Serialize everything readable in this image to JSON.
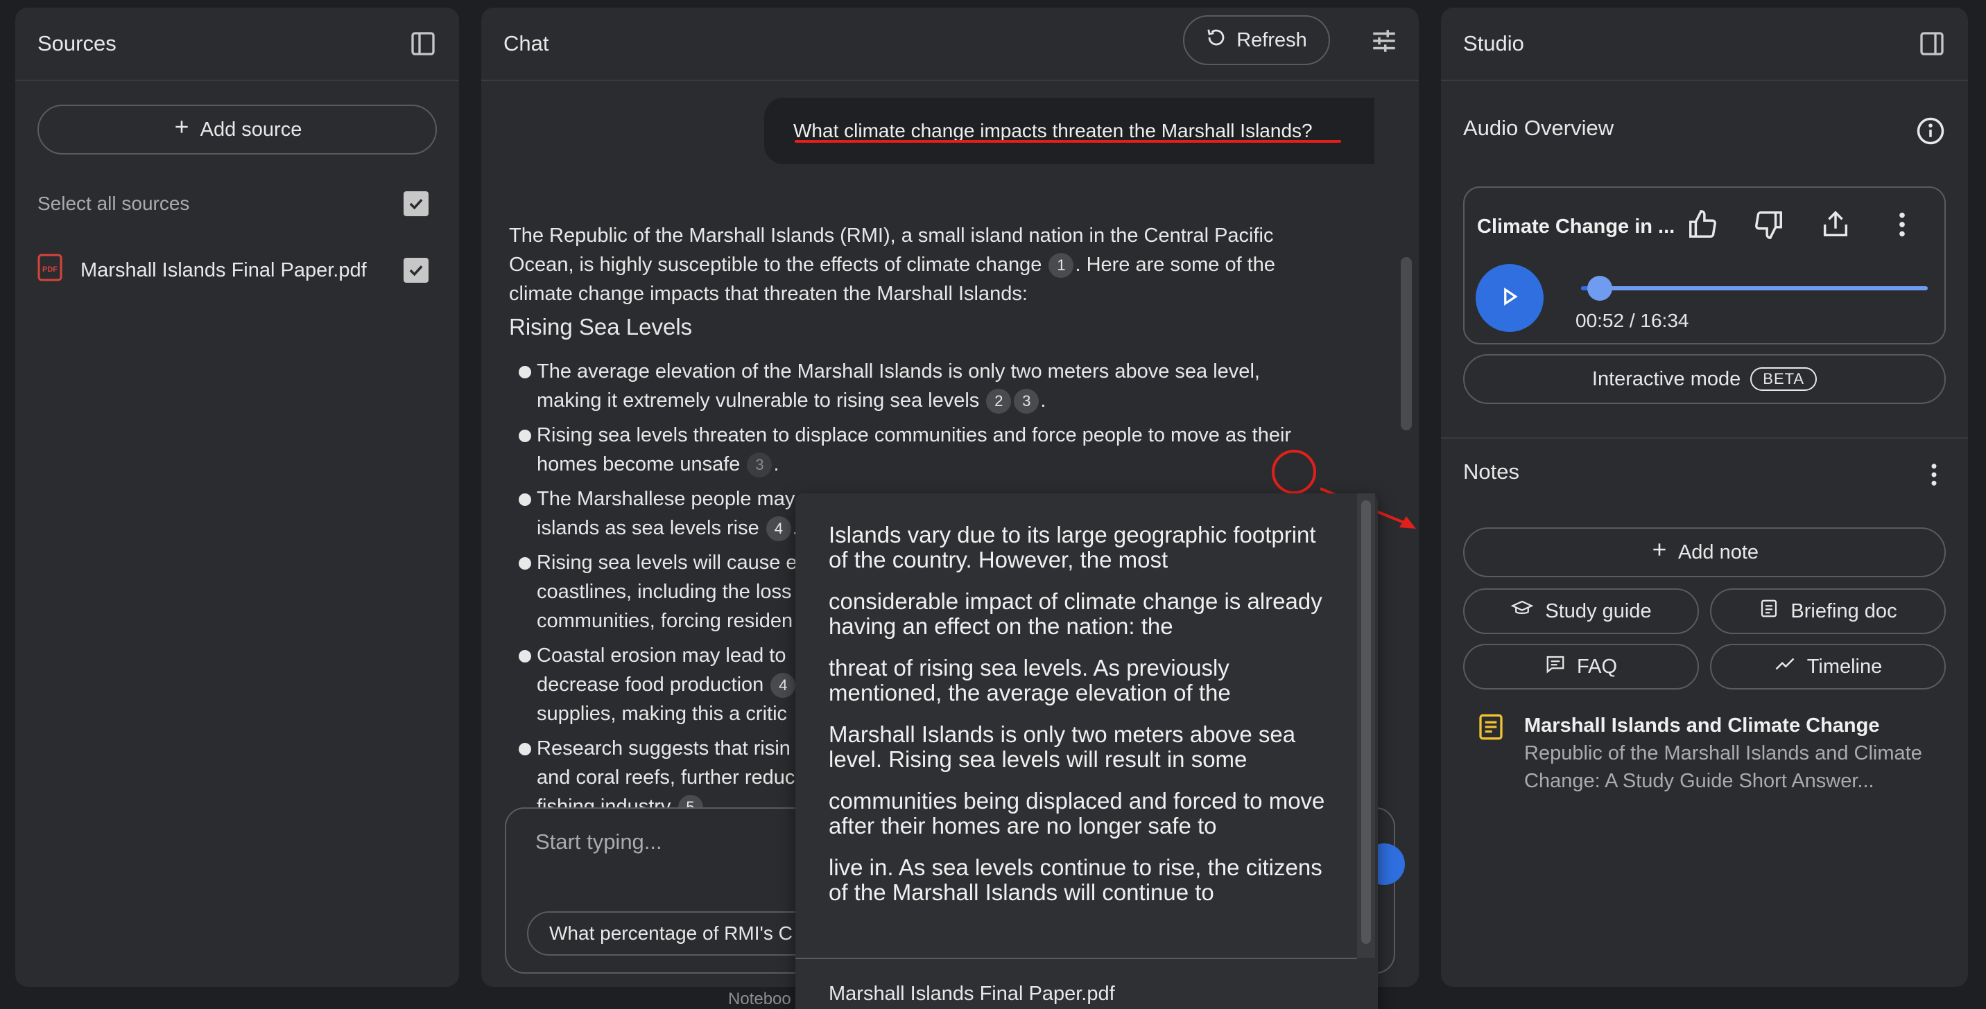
{
  "sources": {
    "title": "Sources",
    "add_source_label": "Add source",
    "select_all_label": "Select all sources",
    "items": [
      {
        "name": "Marshall Islands Final Paper.pdf",
        "type": "PDF"
      }
    ]
  },
  "chat": {
    "title": "Chat",
    "refresh_label": "Refresh",
    "user_question": "What climate change impacts threaten the Marshall Islands?",
    "intro_part1": "The Republic of the Marshall Islands (RMI), a small island nation in the Central Pacific Ocean, is highly susceptible to the effects of climate change",
    "intro_cite": "1",
    "intro_part2": ". Here are some of the climate change impacts that threaten the Marshall Islands:",
    "section_heading": "Rising Sea Levels",
    "bullets": [
      {
        "text": "The average elevation of the Marshall Islands is only two meters above sea level, making it extremely vulnerable to rising sea levels",
        "cites": [
          "2",
          "3"
        ]
      },
      {
        "text": "Rising sea levels threaten to displace communities and force people to move as their homes become unsafe",
        "cites": [
          "3"
        ]
      },
      {
        "text": "The Marshallese people may",
        "text2": "islands as sea levels rise",
        "cites": [
          "4"
        ]
      },
      {
        "text": "Rising sea levels will cause e",
        "text2": "coastlines, including the loss",
        "text3": "communities, forcing residen"
      },
      {
        "text": "Coastal erosion may lead to",
        "text2": "decrease food production",
        "text3": "supplies, making this a critic",
        "cites": [
          "4"
        ]
      },
      {
        "text": "Research suggests that risin",
        "text2": "and coral reefs, further reduc",
        "text3": "fishing industry",
        "cites": [
          "5"
        ]
      }
    ],
    "input_placeholder": "Start typing...",
    "suggestion": "What percentage of RMI's C",
    "footer": "Noteboo"
  },
  "popover": {
    "lines": [
      "Islands vary due to its large geographic footprint of the country. However, the most",
      "considerable impact of climate change is already having an effect on the nation: the",
      "threat of rising sea levels. As previously mentioned, the average elevation of the",
      "Marshall Islands is only two meters above sea level. Rising sea levels will result in some",
      "communities being displaced and forced to move after their homes are no longer safe to",
      "live in. As sea levels continue to rise, the citizens of the Marshall Islands will continue to"
    ],
    "source": "Marshall Islands Final Paper.pdf"
  },
  "studio": {
    "title": "Studio",
    "audio_overview_title": "Audio Overview",
    "audio_card_title": "Climate Change in ...",
    "audio_time": "00:52 / 16:34",
    "audio_progress": 0.053,
    "interactive_label": "Interactive mode",
    "beta_label": "BETA",
    "notes_title": "Notes",
    "add_note_label": "Add note",
    "buttons": {
      "study_guide": "Study guide",
      "briefing_doc": "Briefing doc",
      "faq": "FAQ",
      "timeline": "Timeline"
    },
    "note": {
      "title": "Marshall Islands and Climate Change",
      "preview": "Republic of the Marshall Islands and Climate Change: A Study Guide Short Answer..."
    }
  },
  "colors": {
    "accent_blue": "#2f6fe0",
    "annotation_red": "#e0201a",
    "note_icon_yellow": "#f2c230",
    "pdf_red": "#d9433a"
  }
}
